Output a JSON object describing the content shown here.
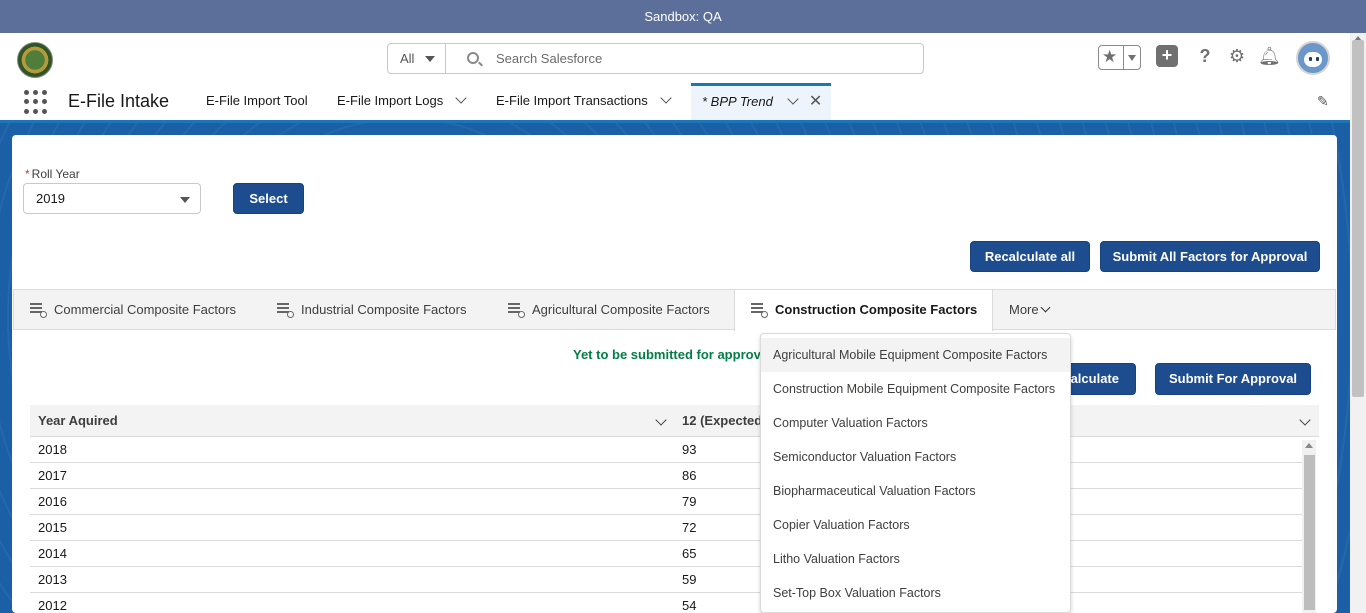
{
  "sandbox_bar": {
    "text": "Sandbox: QA"
  },
  "header": {
    "search_scope": "All",
    "search_placeholder": "Search Salesforce",
    "icons": [
      "favorites-star-icon",
      "add-icon",
      "help-icon",
      "setup-gear-icon",
      "notifications-bell-icon",
      "user-avatar"
    ]
  },
  "nav": {
    "app_name": "E-File Intake",
    "items": [
      {
        "label": "E-File Import Tool"
      },
      {
        "label": "E-File Import Logs"
      },
      {
        "label": "E-File Import Transactions"
      },
      {
        "label": "* BPP Trend"
      }
    ]
  },
  "filter": {
    "roll_year_label": "Roll Year",
    "roll_year_value": "2019",
    "select_button": "Select"
  },
  "actions": {
    "recalculate_all": "Recalculate all",
    "submit_all": "Submit All Factors for Approval",
    "recalculate": "Recalculate",
    "recalculate_visible": "alculate",
    "submit_for_approval": "Submit For Approval"
  },
  "tabs": {
    "items": [
      {
        "label": "Commercial Composite Factors"
      },
      {
        "label": "Industrial Composite Factors"
      },
      {
        "label": "Agricultural Composite Factors"
      },
      {
        "label": "Construction Composite Factors"
      }
    ],
    "active_index": 3,
    "more_label": "More"
  },
  "status": {
    "text": "Yet to be submitted for approval",
    "visible_text": "Yet to be submitted for approv",
    "color": "#027e46"
  },
  "table": {
    "columns": [
      "Year Aquired",
      "12 (Expected"
    ],
    "rows": [
      [
        "2018",
        "93"
      ],
      [
        "2017",
        "86"
      ],
      [
        "2016",
        "79"
      ],
      [
        "2015",
        "72"
      ],
      [
        "2014",
        "65"
      ],
      [
        "2013",
        "59"
      ],
      [
        "2012",
        "54"
      ]
    ]
  },
  "more_menu": {
    "items": [
      "Agricultural Mobile Equipment Composite Factors",
      "Construction Mobile Equipment Composite Factors",
      "Computer Valuation Factors",
      "Semiconductor Valuation Factors",
      "Biopharmaceutical Valuation Factors",
      "Copier Valuation Factors",
      "Litho Valuation Factors",
      "Set-Top Box Valuation Factors"
    ],
    "hovered_index": 0
  },
  "colors": {
    "brand_button": "#1d4c8f",
    "sandbox_bar": "#5b6f9a",
    "banner": "#1b5fa7",
    "active_tab_indicator": "#1b75bb"
  }
}
